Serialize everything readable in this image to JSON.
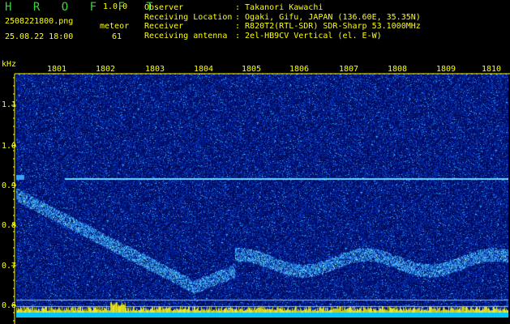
{
  "header": {
    "logo": "H R O F F T",
    "version": "1.0.0",
    "filename": "2508221800.png",
    "meteor_label": "meteor",
    "datetime": "25.08.22 18:00",
    "meteor_count": "61"
  },
  "info": [
    {
      "key": "Observer",
      "value": ": Takanori Kawachi"
    },
    {
      "key": "Receiving Location",
      "value": ": Ogaki, Gifu, JAPAN (136.60E, 35.35N)"
    },
    {
      "key": "Receiver",
      "value": ": R820T2(RTL-SDR) SDR-Sharp 53.1000MHz"
    },
    {
      "key": "Receiving antenna",
      "value": ": 2el-HB9CV Vertical (el. E-W)"
    }
  ],
  "axis": {
    "unit": "kHz",
    "x_ticks": [
      "1801",
      "1802",
      "1803",
      "1804",
      "1805",
      "1806",
      "1807",
      "1808",
      "1809",
      "1810"
    ],
    "y_ticks": [
      "1.1",
      "1.0",
      "0.9",
      "0.8",
      "0.7",
      "0.6"
    ]
  },
  "colors": {
    "text": "#ffff00",
    "logo": "#3cd23c",
    "background": "#001060",
    "signal": "#00e0ff",
    "carrier": "#4fd0ff",
    "bottom_bar": "#00c8ff"
  }
}
